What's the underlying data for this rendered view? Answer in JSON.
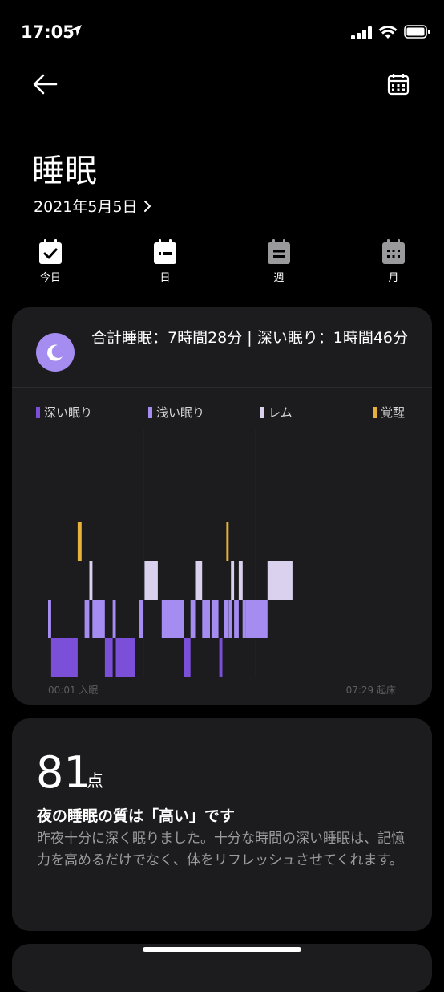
{
  "status": {
    "time": "17:05"
  },
  "header": {
    "title": "睡眠",
    "date": "2021年5月5日"
  },
  "tabs": [
    {
      "label": "今日",
      "icon": "calendar-check-icon"
    },
    {
      "label": "日",
      "icon": "calendar-day-icon"
    },
    {
      "label": "週",
      "icon": "calendar-week-icon"
    },
    {
      "label": "月",
      "icon": "calendar-month-icon"
    }
  ],
  "summary": {
    "text": "合計睡眠：7時間28分 | 深い眠り：1時間46分",
    "legend": [
      {
        "label": "深い眠り",
        "color": "#7b4fd8"
      },
      {
        "label": "浅い眠り",
        "color": "#a48cf0"
      },
      {
        "label": "レム",
        "color": "#d9d1ee"
      },
      {
        "label": "覚醒",
        "color": "#e8b03d"
      }
    ],
    "start_label": "00:01 入眠",
    "end_label": "07:29 起床"
  },
  "chart_data": {
    "type": "bar",
    "x_unit": "minutes",
    "x_range": [
      1,
      449
    ],
    "stages": [
      "深い眠り",
      "浅い眠り",
      "レム",
      "覚醒"
    ],
    "segments": [
      {
        "stage": "浅い眠り",
        "start": 1,
        "end": 5
      },
      {
        "stage": "深い眠り",
        "start": 5,
        "end": 39
      },
      {
        "stage": "覚醒",
        "start": 39,
        "end": 44
      },
      {
        "stage": "浅い眠り",
        "start": 48,
        "end": 54
      },
      {
        "stage": "レム",
        "start": 54,
        "end": 58
      },
      {
        "stage": "浅い眠り",
        "start": 58,
        "end": 74
      },
      {
        "stage": "深い眠り",
        "start": 74,
        "end": 84
      },
      {
        "stage": "浅い眠り",
        "start": 84,
        "end": 88
      },
      {
        "stage": "深い眠り",
        "start": 88,
        "end": 113
      },
      {
        "stage": "浅い眠り",
        "start": 118,
        "end": 123
      },
      {
        "stage": "レム",
        "start": 125,
        "end": 142
      },
      {
        "stage": "浅い眠り",
        "start": 147,
        "end": 175
      },
      {
        "stage": "深い眠り",
        "start": 175,
        "end": 184
      },
      {
        "stage": "浅い眠り",
        "start": 184,
        "end": 190
      },
      {
        "stage": "レム",
        "start": 190,
        "end": 199
      },
      {
        "stage": "浅い眠り",
        "start": 199,
        "end": 209
      },
      {
        "stage": "覚醒",
        "start": 230,
        "end": 233
      },
      {
        "stage": "浅い眠り",
        "start": 211,
        "end": 220
      },
      {
        "stage": "深い眠り",
        "start": 221,
        "end": 225
      },
      {
        "stage": "浅い眠り",
        "start": 227,
        "end": 232
      },
      {
        "stage": "浅い眠り",
        "start": 233,
        "end": 237
      },
      {
        "stage": "レム",
        "start": 236,
        "end": 240
      },
      {
        "stage": "浅い眠り",
        "start": 240,
        "end": 246
      },
      {
        "stage": "レム",
        "start": 246,
        "end": 251
      },
      {
        "stage": "浅い眠り",
        "start": 251,
        "end": 255
      },
      {
        "stage": "浅い眠り",
        "start": 255,
        "end": 283
      },
      {
        "stage": "レム",
        "start": 283,
        "end": 315
      }
    ]
  },
  "score": {
    "value": "81",
    "unit": "点",
    "title": "夜の睡眠の質は「高い」です",
    "description": "昨夜十分に深く眠りました。十分な時間の深い睡眠は、記憶力を高めるだけでなく、体をリフレッシュさせてくれます。"
  }
}
